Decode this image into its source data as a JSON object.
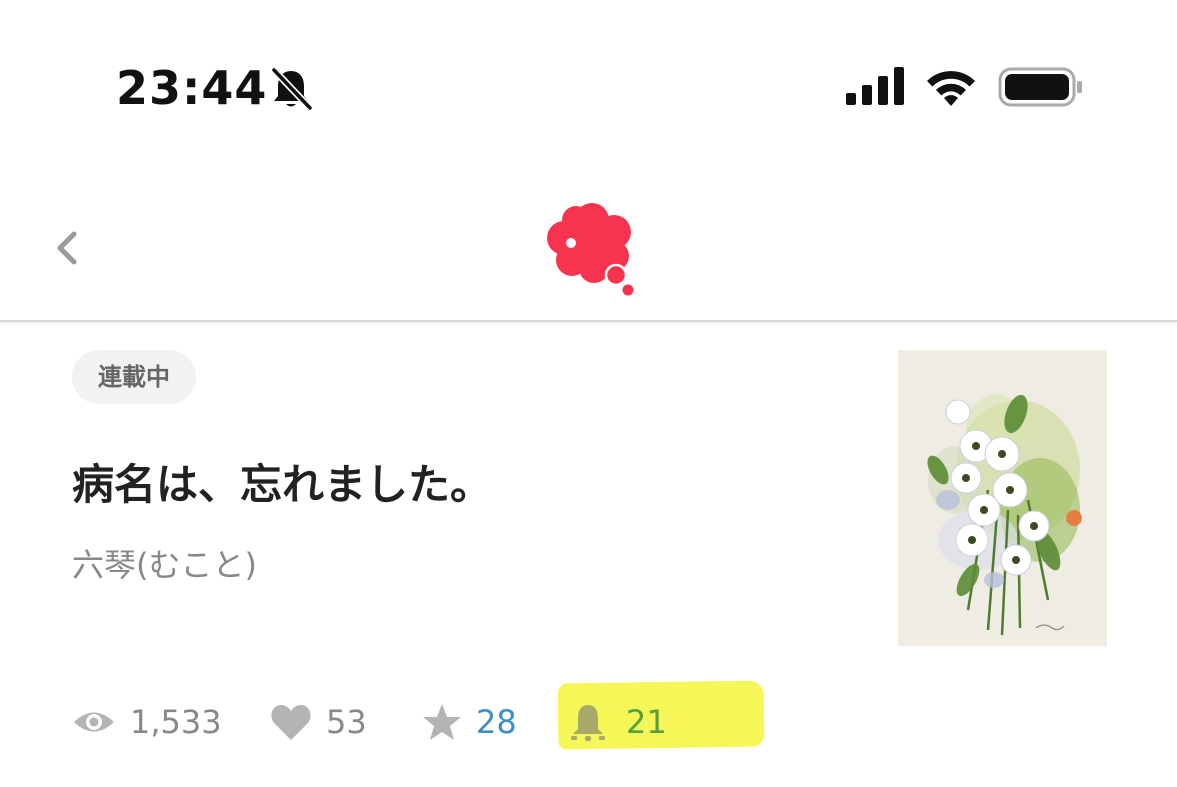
{
  "status_bar": {
    "time": "23:44",
    "icons": [
      "bell-slash-icon",
      "cellular-signal-icon",
      "wifi-icon",
      "battery-icon"
    ]
  },
  "header": {
    "back_icon": "chevron-left-icon",
    "logo_icon": "thought-bubble-logo-icon",
    "logo_color": "#f7344f"
  },
  "work": {
    "status_badge": "連載中",
    "title": "病名は、忘れました。",
    "author": "六琴(むこと)",
    "stats": {
      "views": "1,533",
      "likes": "53",
      "stars": "28",
      "bells": "21"
    },
    "stat_icons": [
      "eye-icon",
      "heart-icon",
      "star-icon",
      "bell-icon"
    ]
  },
  "colors": {
    "muted_gray": "#888888",
    "icon_gray": "#b4b4b4",
    "star_value_blue": "#3d8fc1",
    "bell_value_green": "#57a03c",
    "highlight_yellow": "#f4f54a"
  }
}
